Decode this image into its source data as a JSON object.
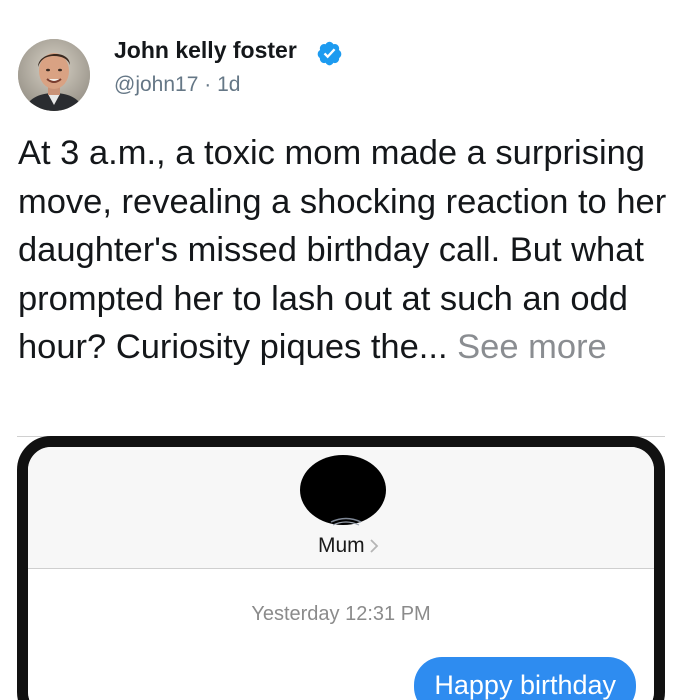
{
  "tweet": {
    "author_name": "John kelly foster",
    "handle": "@john17",
    "separator": "·",
    "time_ago": "1d",
    "text": "At 3 a.m., a toxic mom made a surprising move, revealing a shocking reaction to her daughter's missed birthday call. But what prompted her to lash out at such an odd hour? Curiosity piques the...",
    "see_more_label": "See more",
    "verified_icon": "verified-badge-icon",
    "colors": {
      "verified": "#1d9bf0",
      "see_more": "#8a8d91",
      "name": "#14171a",
      "handle": "#657786"
    }
  },
  "embedded_screenshot": {
    "contact_name": "Mum",
    "contact_chevron_icon": "chevron-right-icon",
    "timestamp": "Yesterday 12:31 PM",
    "messages": [
      {
        "sender": "me",
        "text": "Happy birthday"
      }
    ],
    "colors": {
      "bubble": "#2e8cf0",
      "frame": "#111111"
    }
  }
}
